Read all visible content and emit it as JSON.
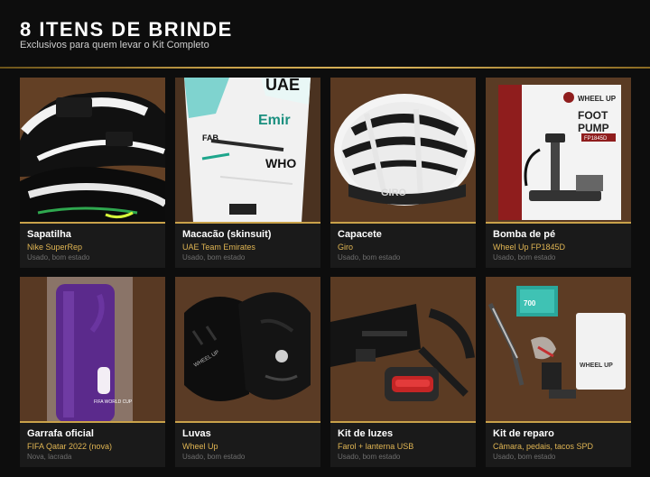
{
  "header": {
    "title": "8 ITENS DE BRINDE",
    "subtitle": "Exclusivos para quem levar o Kit Completo"
  },
  "colors": {
    "background": "#0d0d0d",
    "card": "#1a1a1a",
    "accent_gold": "#c9a24a",
    "model_text": "#e0b553",
    "condition_text": "#6e6e6e"
  },
  "photo_texts": {
    "helmet_brand": "GIRO",
    "pump_brand": "WHEEL UP",
    "pump_line1": "FOOT",
    "pump_line2": "PUMP",
    "pump_model": "FP1845D",
    "bottle_text": "FIFA WORLD CUP",
    "gloves_brand": "WHEEL UP",
    "tubes_label": "700",
    "bag_brand": "WHEEL UP"
  },
  "items": [
    {
      "name": "Sapatilha",
      "model": "Nike SuperRep",
      "condition": "Usado, bom estado",
      "icon": "cycling-shoes-photo"
    },
    {
      "name": "Macacão (skinsuit)",
      "model": "UAE Team Emirates",
      "condition": "Usado, bom estado",
      "icon": "skinsuit-photo"
    },
    {
      "name": "Capacete",
      "model": "Giro",
      "condition": "Usado, bom estado",
      "icon": "helmet-photo"
    },
    {
      "name": "Bomba de pé",
      "model": "Wheel Up FP1845D",
      "condition": "Usado, bom estado",
      "icon": "floor-pump-photo"
    },
    {
      "name": "Garrafa oficial",
      "model": "FIFA Qatar 2022 (nova)",
      "condition": "Nova, lacrada",
      "icon": "bottle-photo"
    },
    {
      "name": "Luvas",
      "model": "Wheel Up",
      "condition": "Usado, bom estado",
      "icon": "gloves-photo"
    },
    {
      "name": "Kit de luzes",
      "model": "Farol + lanterna USB",
      "condition": "Usado, bom estado",
      "icon": "lights-photo"
    },
    {
      "name": "Kit de reparo",
      "model": "Câmara, pedais, tacos SPD",
      "condition": "Usado, bom estado",
      "icon": "repair-kit-photo"
    }
  ]
}
